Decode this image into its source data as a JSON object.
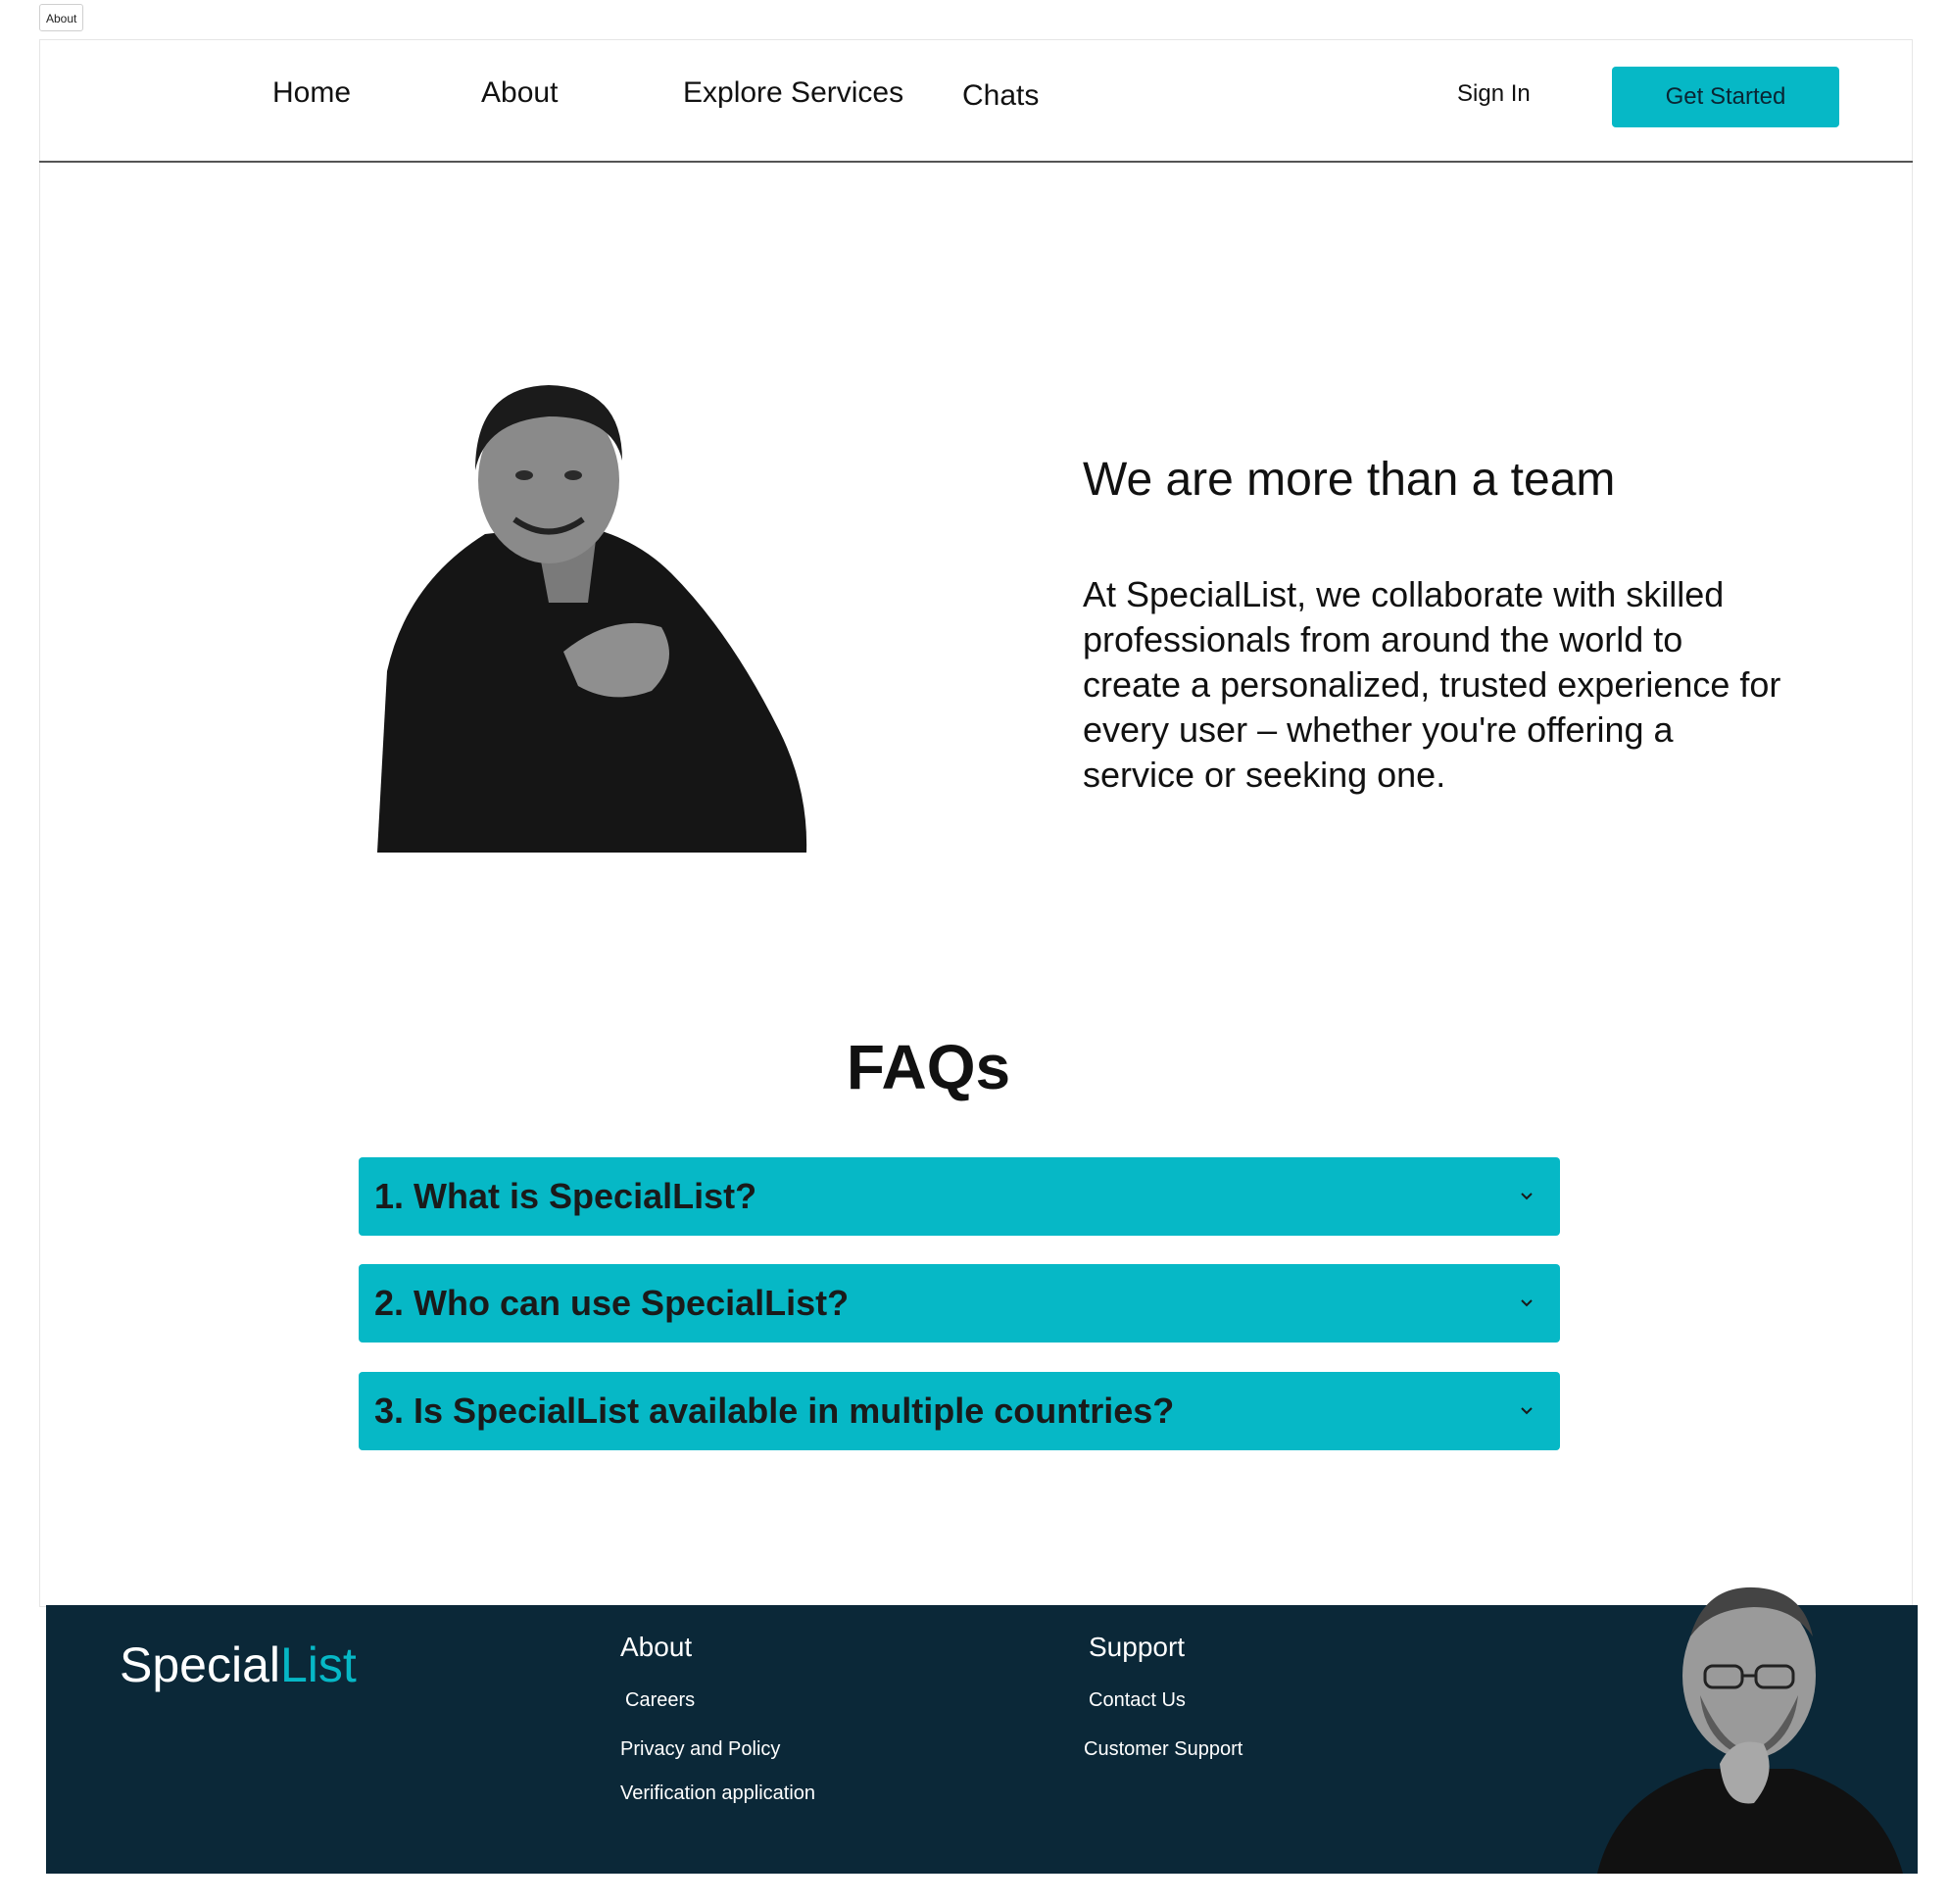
{
  "tab": {
    "label": "About"
  },
  "nav": {
    "items": [
      "Home",
      "About",
      "Explore Services",
      "Chats"
    ],
    "sign_in": "Sign In",
    "get_started": "Get Started"
  },
  "hero": {
    "title": "We are more than a team",
    "text": "At SpecialList, we collaborate with skilled professionals from around the world to create a personalized, trusted experience for every user – whether you're offering a service or seeking one."
  },
  "faq": {
    "title": "FAQs",
    "items": [
      "1. What is SpecialList?",
      "2. Who can use SpecialList?",
      "3. Is SpecialList available in multiple countries?"
    ]
  },
  "footer": {
    "brand_part1": "Special",
    "brand_part2": "List",
    "about_heading": "About",
    "about_links": [
      "Careers",
      "Privacy and Policy",
      "Verification application"
    ],
    "support_heading": "Support",
    "support_links": [
      "Contact Us",
      "Customer Support"
    ]
  },
  "colors": {
    "accent": "#06b8c6",
    "footer_bg": "#0b2838",
    "text": "#111111"
  },
  "icons": {
    "faq_toggle": "chevron-down-icon"
  }
}
